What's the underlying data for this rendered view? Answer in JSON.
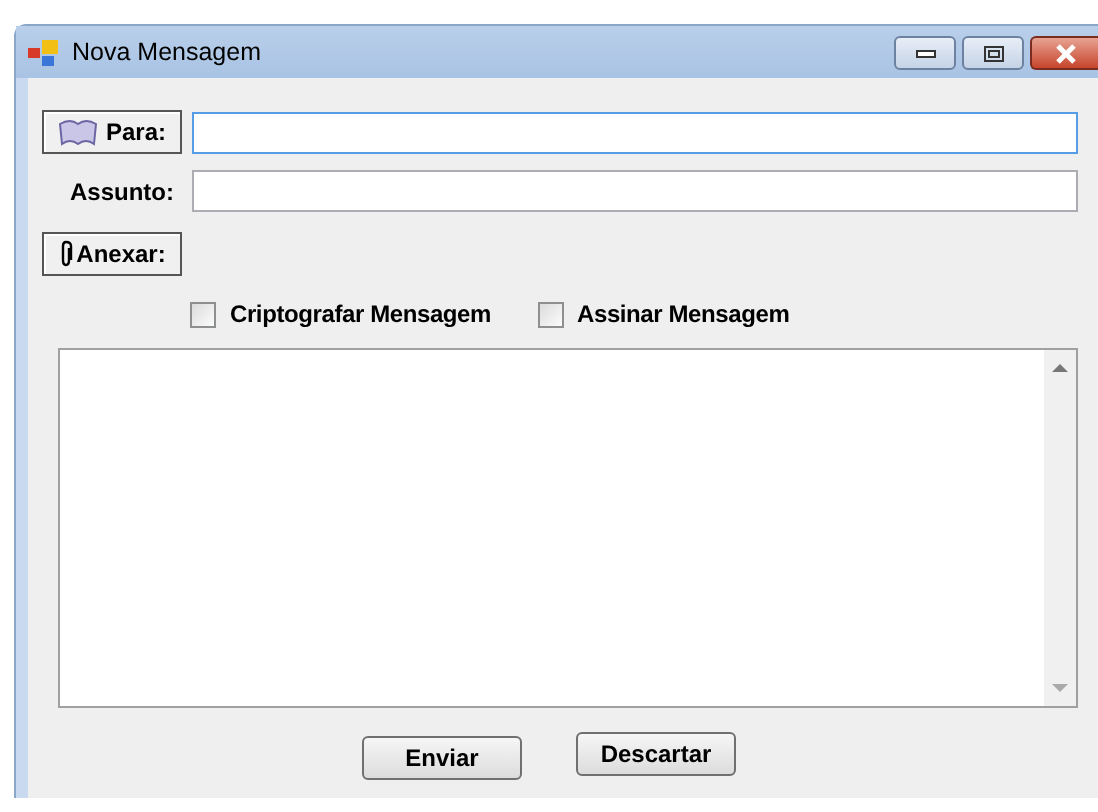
{
  "window": {
    "title": "Nova Mensagem"
  },
  "to_button": {
    "label": "Para:"
  },
  "subject": {
    "label": "Assunto:"
  },
  "attach_button": {
    "label": "Anexar:"
  },
  "options": [
    {
      "label": "Criptografar Mensagem",
      "checked": false
    },
    {
      "label": "Assinar Mensagem",
      "checked": false
    }
  ],
  "buttons": [
    {
      "label": "Enviar"
    },
    {
      "label": "Descartar"
    }
  ]
}
